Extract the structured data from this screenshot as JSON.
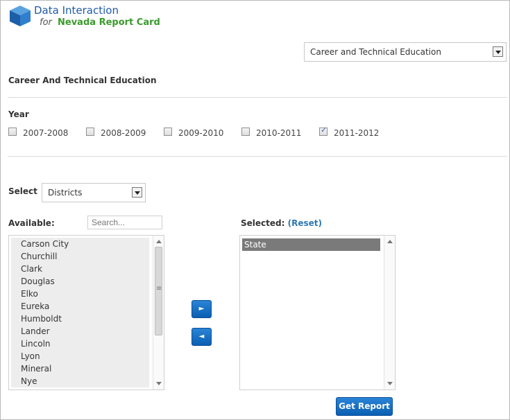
{
  "brand": {
    "title": "Data Interaction",
    "sub_prefix": "for",
    "sub_name": "Nevada Report Card"
  },
  "report_type_select": {
    "value": "Career and Technical Education"
  },
  "section_title": "Career And Technical Education",
  "year": {
    "label": "Year",
    "options": [
      {
        "label": "2007-2008",
        "checked": false
      },
      {
        "label": "2008-2009",
        "checked": false
      },
      {
        "label": "2009-2010",
        "checked": false
      },
      {
        "label": "2010-2011",
        "checked": false
      },
      {
        "label": "2011-2012",
        "checked": true
      }
    ]
  },
  "level_select": {
    "label": "Select",
    "value": "Districts"
  },
  "available": {
    "label": "Available:",
    "search_placeholder": "Search...",
    "items": [
      "Carson City",
      "Churchill",
      "Clark",
      "Douglas",
      "Elko",
      "Eureka",
      "Humboldt",
      "Lander",
      "Lincoln",
      "Lyon",
      "Mineral",
      "Nye"
    ]
  },
  "selected": {
    "label": "Selected:",
    "reset_label": "(Reset)",
    "items": [
      "State"
    ]
  },
  "buttons": {
    "add_glyph": "►",
    "remove_glyph": "◄",
    "get_report": "Get Report"
  },
  "icons": {
    "logo": "data-cube-icon"
  },
  "colors": {
    "accent_blue": "#1f5aa6",
    "brand_green": "#3a9a2c",
    "button_blue": "#0b5fb3",
    "link_blue": "#2e79b4"
  }
}
